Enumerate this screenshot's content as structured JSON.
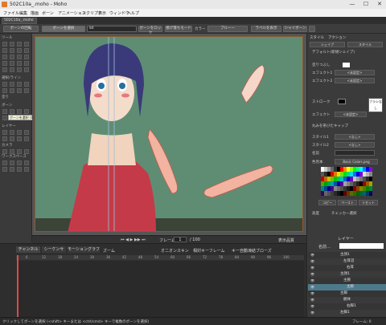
{
  "window": {
    "title": "502C10a_.moho - Moho",
    "min": "—",
    "max": "☐",
    "close": "✕"
  },
  "menu": [
    "ファイル",
    "編集",
    "描画",
    "ボーン",
    "アニメーション",
    "スクリプト",
    "表示",
    "ウィンドウ",
    "ヘルプ"
  ],
  "doc_tab": "502C10a_.moho ×",
  "options_bar": {
    "bone_dropdown": "ボーンの回転",
    "select_bone_btn": "ボーンを選択",
    "field_value": "84",
    "lock_bone": "ボーンをロック",
    "ik_mode": "接げ落ちモード",
    "color_label": "カラー",
    "color_value": "ブルーー",
    "show_label": "ラベルを表示",
    "shy_bone": "シャイボーン"
  },
  "tools": {
    "headers": [
      "ツール",
      "選択/ライン",
      "塗り",
      "ボーン",
      "レイヤー",
      "カメラ",
      "ワークスペース"
    ],
    "tooltip": "ボーンを選択 (B)"
  },
  "viewport": {
    "bg_color": "#5f8d74",
    "frame_label": "フレーム",
    "frame_value": "1",
    "total_frames": "/ 100",
    "display_label": "表示品質"
  },
  "style_panel": {
    "tabs": [
      "スタイル",
      "アクション"
    ],
    "shape_btn": "シェイプ",
    "style_btn": "スタイル",
    "default_label": "デフォルト(新規シェイプ)",
    "fill_label": "塗りつぶし",
    "effect1_label": "エフェクト1",
    "effect1_value": "<未設定>",
    "effect2_label": "エフェクト2",
    "effect2_value": "<未設定>",
    "stroke_label": "ストローク",
    "brush_btn": "ブラシなし",
    "effect_label": "エフェクト",
    "effect_value": "<未設定>",
    "round_caps": "丸みを帯びたキャップ",
    "style1_label": "スタイル1",
    "style1_value": "<なし>",
    "style2_label": "スタイル2",
    "style2_value": "<なし>",
    "name_label": "名前",
    "palette_label": "色見本",
    "palette_value": "Basic Colors.png",
    "copy_btn": "コピー",
    "paste_btn": "ペースト",
    "reset_btn": "リセット",
    "advanced_label": "高度",
    "checker_label": "チェッカー選択"
  },
  "timeline": {
    "tabs": [
      "チャンネル",
      "シーケンサ",
      "モーショングラフ"
    ],
    "zoom_label": "ズーム",
    "onion_label": "オニオンスキン",
    "relative_label": "相対キーフレーム",
    "auto_freeze": "キー自動凍結ブローズ",
    "ticks": [
      "6",
      "12",
      "18",
      "24",
      "30",
      "36",
      "42",
      "48",
      "54",
      "60",
      "66",
      "72",
      "78",
      "84",
      "90",
      "96",
      "100"
    ]
  },
  "layers_panel": {
    "title": "レイヤー",
    "name_label": "名前…",
    "rows": [
      "主顔1",
      "左耳首",
      "右耳",
      "主顔1",
      "主腕",
      "主腕",
      "主脚",
      "胴体",
      "右脚1",
      "左脚1"
    ]
  },
  "status": {
    "left": "クリックしてボーンを選択 (<shift> キーまたは <ctrl/cmd> キーで複数のボーンを選択)",
    "right": "フレーム: 0"
  }
}
